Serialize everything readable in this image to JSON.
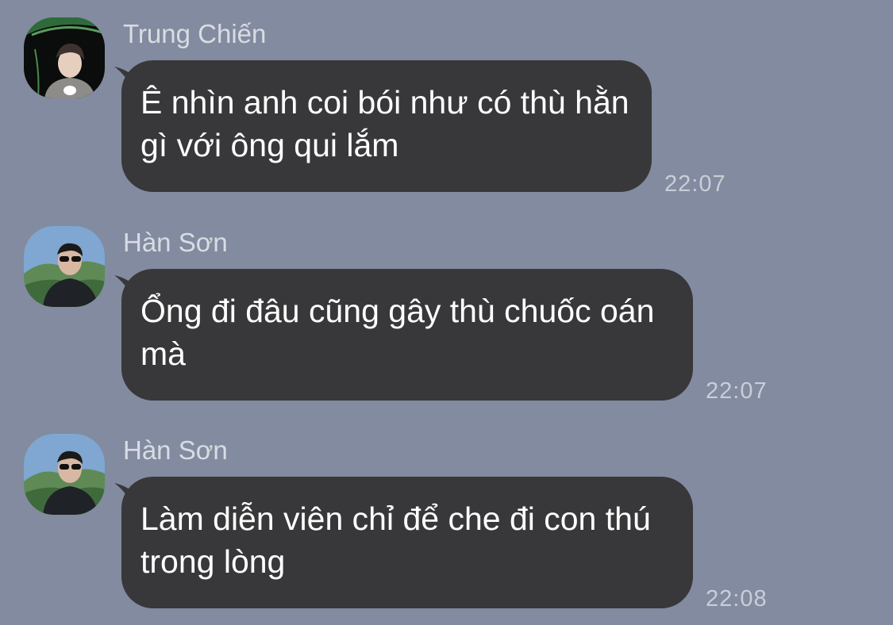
{
  "messages": [
    {
      "sender": "Trung Chiến",
      "avatar_icon": "user-avatar-trung-chien",
      "text": "Ê nhìn anh coi bói như có thù hằn gì với ông qui lắm",
      "time": "22:07"
    },
    {
      "sender": "Hàn Sơn",
      "avatar_icon": "user-avatar-han-son",
      "text": "Ổng đi đâu cũng gây thù chuốc oán mà",
      "time": "22:07"
    },
    {
      "sender": "Hàn Sơn",
      "avatar_icon": "user-avatar-han-son",
      "text": "Làm diễn viên chỉ để che đi con thú trong lòng",
      "time": "22:08"
    }
  ],
  "colors": {
    "background": "#828b9f",
    "bubble": "#38383a",
    "bubble_text": "#ffffff",
    "sender_text": "#d9dce3",
    "time_text": "#c9ced8"
  }
}
